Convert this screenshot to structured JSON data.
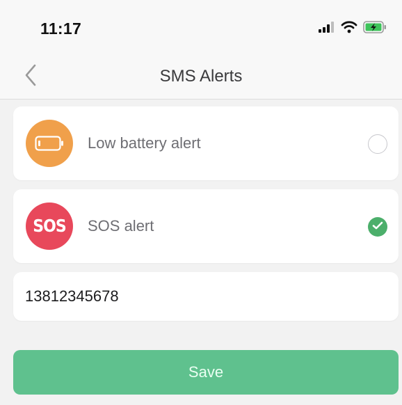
{
  "status_bar": {
    "time": "11:17",
    "signal_icon": "cellular-signal-icon",
    "wifi_icon": "wifi-icon",
    "battery_icon": "battery-charging-icon"
  },
  "nav": {
    "back_icon": "chevron-left-icon",
    "title": "SMS Alerts"
  },
  "alerts": [
    {
      "label": "Low battery alert",
      "icon": "battery-icon",
      "icon_color": "#f0a04b",
      "selected": false
    },
    {
      "label": "SOS alert",
      "icon": "sos-icon",
      "icon_text": "SOS",
      "icon_color": "#e8485b",
      "selected": true
    }
  ],
  "phone": {
    "value": "13812345678"
  },
  "save": {
    "label": "Save",
    "color": "#5fc18e"
  },
  "colors": {
    "check_green": "#4caf6b",
    "background": "#f2f2f2"
  }
}
